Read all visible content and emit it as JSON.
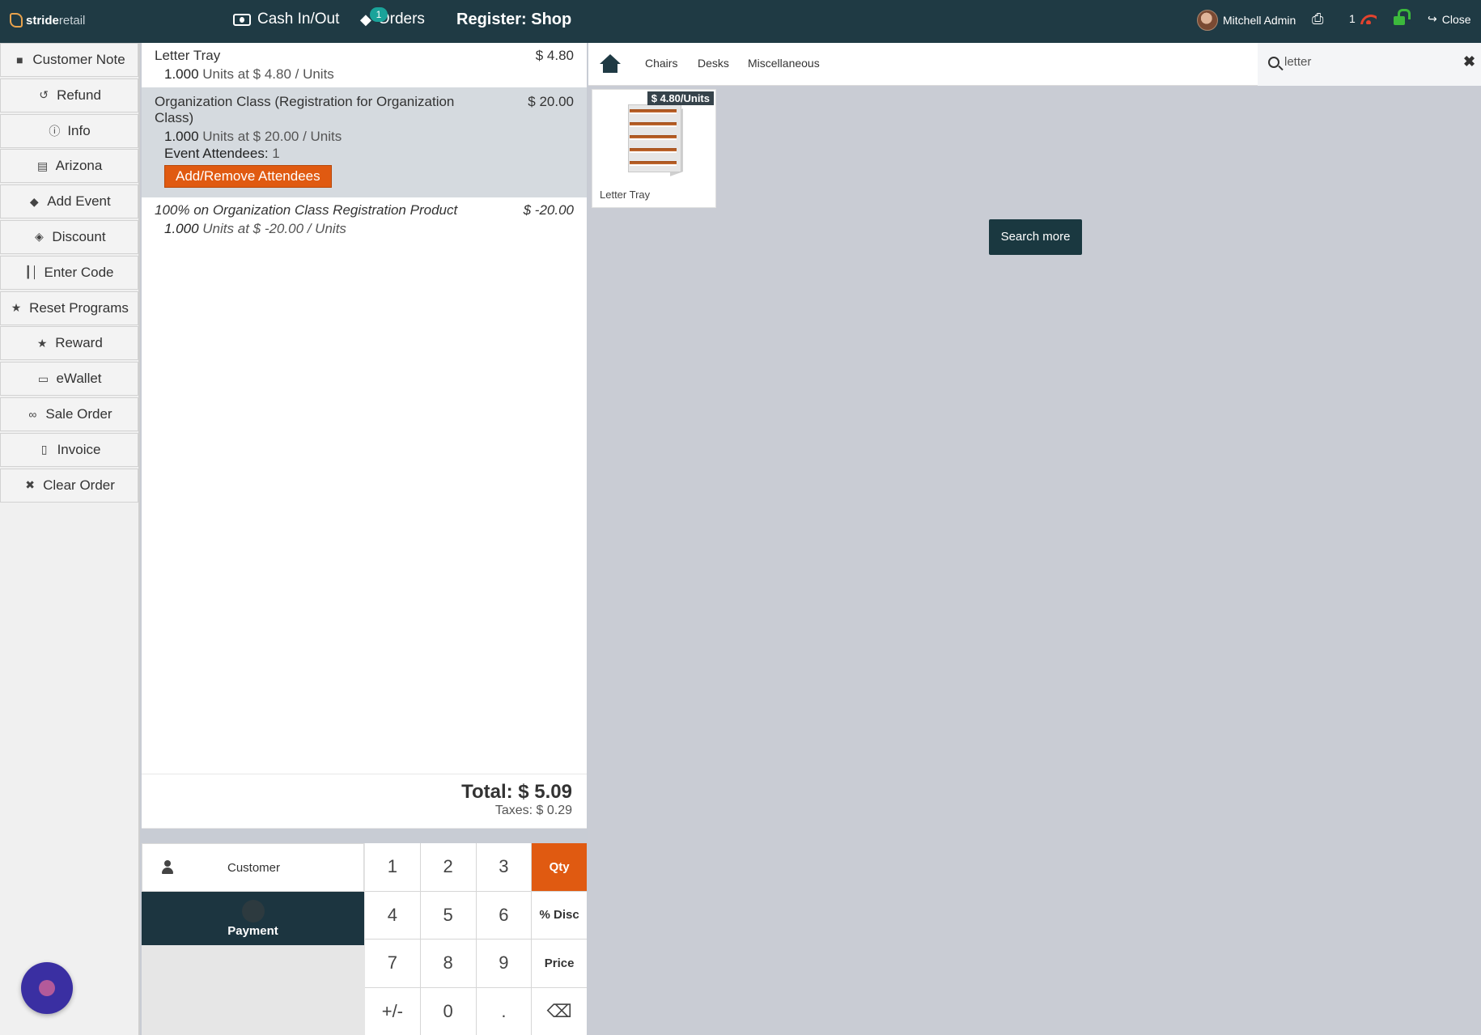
{
  "topbar": {
    "logo_bold": "stride",
    "logo_light": "retail",
    "cash_label": "Cash In/Out",
    "orders_label": "Orders",
    "orders_badge": "1",
    "register_title": "Register: Shop",
    "user_name": "Mitchell Admin",
    "wifi_count": "1",
    "close_label": "Close"
  },
  "control_buttons": [
    {
      "label": "Customer Note",
      "icon": "note-icon"
    },
    {
      "label": "Refund",
      "icon": "undo-icon"
    },
    {
      "label": "Info",
      "icon": "info-icon"
    },
    {
      "label": "Arizona",
      "icon": "book-icon"
    },
    {
      "label": "Add Event",
      "icon": "ticket-icon"
    },
    {
      "label": "Discount",
      "icon": "tag-icon"
    },
    {
      "label": "Enter Code",
      "icon": "barcode-icon"
    },
    {
      "label": "Reset Programs",
      "icon": "star-icon"
    },
    {
      "label": "Reward",
      "icon": "star-icon"
    },
    {
      "label": "eWallet",
      "icon": "card-icon"
    },
    {
      "label": "Sale Order",
      "icon": "link-icon"
    },
    {
      "label": "Invoice",
      "icon": "pdf-icon"
    },
    {
      "label": "Clear Order",
      "icon": "close-icon"
    }
  ],
  "order": {
    "lines": [
      {
        "name": "Letter Tray",
        "price": "$ 4.80",
        "qty": "1.000",
        "detail": "Units at $ 4.80 / Units"
      },
      {
        "name": "Organization Class (Registration for Organization Class)",
        "price": "$ 20.00",
        "qty": "1.000",
        "detail": "Units at $ 20.00 / Units",
        "attendees_label": "Event Attendees:",
        "attendees_value": "1",
        "attendees_button": "Add/Remove Attendees"
      },
      {
        "name": "100% on Organization Class Registration Product",
        "price": "$ -20.00",
        "qty": "1.000",
        "detail": "Units at $ -20.00 / Units"
      }
    ],
    "total": "Total: $ 5.09",
    "taxes": "Taxes: $ 0.29"
  },
  "pad": {
    "customer_label": "Customer",
    "payment_label": "Payment",
    "keys": [
      "1",
      "2",
      "3",
      "Qty",
      "4",
      "5",
      "6",
      "% Disc",
      "7",
      "8",
      "9",
      "Price",
      "+/-",
      "0",
      ".",
      "⌫"
    ],
    "active_mode": "Qty"
  },
  "products": {
    "categories": [
      "Chairs",
      "Desks",
      "Miscellaneous"
    ],
    "search_value": "letter",
    "items": [
      {
        "name": "Letter Tray",
        "price_tag": "$ 4.80/Units"
      }
    ],
    "search_more_label": "Search more"
  },
  "colors": {
    "topbar": "#1f3a44",
    "accent_orange": "#e05a11",
    "payment_dark": "#1c3540",
    "badge_teal": "#1aa39a"
  }
}
